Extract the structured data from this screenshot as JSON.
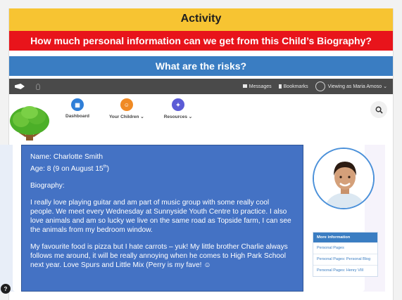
{
  "slide": {
    "activity_title": "Activity",
    "question": "How much personal information can we get from this Child’s Biography?",
    "risks_question": "What are the risks?"
  },
  "app_top": {
    "messages": "Messages",
    "bookmarks": "Bookmarks",
    "viewing_as": "Viewing as Maria Amoso"
  },
  "nav": {
    "dashboard": "Dashboard",
    "children": "Your Children",
    "resources": "Resources",
    "colors": {
      "dashboard": "#2f7fd8",
      "children": "#f08a24",
      "resources": "#5b5bd6"
    }
  },
  "biography": {
    "name": "Name: Charlotte Smith",
    "age_prefix": "Age: 8 (9 on August 15",
    "age_sup": "th",
    "age_suffix": ")",
    "heading": "Biography:",
    "paragraph1": "I really love playing guitar and am part of music group with some really cool people. We meet every Wednesday at Sunnyside Youth Centre to practice. I also love animals and am so lucky we live on the same road as Topside farm, I can see the animals from my bedroom window.",
    "paragraph2": "My favourite food is pizza but I hate carrots – yuk! My little brother Charlie  always follows me around, it will be really annoying when he comes to High Park School next year. Love Spurs and Little Mix (Perry is my fave! ☺"
  },
  "info_box": {
    "header": "More information",
    "items": [
      "Personal Pages",
      "Personal Pages: Personal Blog",
      "Personal Pages: Henry VIII"
    ]
  },
  "help": "?"
}
